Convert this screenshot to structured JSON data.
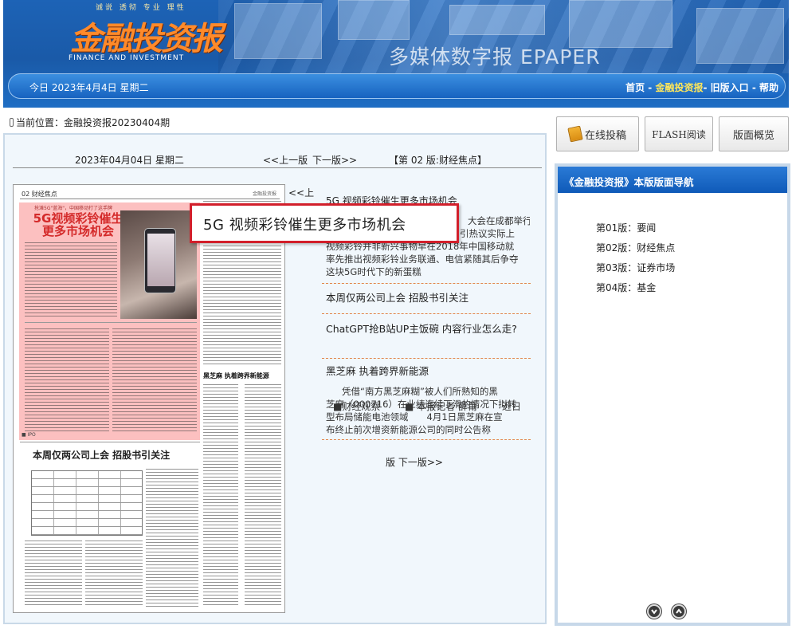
{
  "banner": {
    "slogan": "诚说  透彻  专业  理性",
    "logo_cn": "金融投资报",
    "logo_en": "FINANCE AND INVESTMENT",
    "epaper": "多媒体数字报 EPAPER",
    "today": "今日 2023年4月4日 星期二",
    "nav": {
      "home": "首页",
      "sep1": " - ",
      "paper": "金融投资报",
      "sep2": "- ",
      "old": "旧版入口",
      "sep3": " - ",
      "help": "帮助"
    }
  },
  "location": "当前位置：金融投资报20230404期",
  "page_head": {
    "date": "2023年04月04日 星期二",
    "prev": "<<上一版",
    "next": "下一版>>",
    "label": "【第 02 版:财经焦点】"
  },
  "thumbnail": {
    "section": "02 财经焦点",
    "section_right": "金融投资报",
    "pre_headline": "抢滩5G\"蓝海\"，中国移动打了这手牌",
    "headline": "5G视频彩铃催生更多市场机会",
    "sub_headline": "本周仅两公司上会 招股书引关注",
    "black_headline": "黑芝麻 执着跨界新能源",
    "tag": "■ IPO"
  },
  "tooltip": "5G 视频彩铃催生更多市场机会",
  "mini_prev": "<<上",
  "articles": [
    {
      "title": "5G 视频彩铃催生更多市场机会",
      "summary_lines": [
        "大会在成都举行",
        "引热议实际上",
        "视频彩铃并非新兴事物早在2018年中国移动就",
        "率先推出视频彩铃业务联通、电信紧随其后争夺",
        "这块5G时代下的新蛋糕"
      ]
    },
    {
      "title": "本周仅两公司上会 招股书引关注"
    },
    {
      "title": "ChatGPT抢B站UP主饭碗 内容行业怎么走?",
      "meta": [
        "■财经观察",
        "■ 本报记者 薛莆",
        "近日"
      ]
    },
    {
      "title": "黑芝麻 执着跨界新能源",
      "summary_lines": [
        "凭借“南方黑芝麻糊”被人们所熟知的黑",
        "芝麻（000716）在业绩连续下滑的情况下拟转",
        "型布局储能电池领域　　4月1日黑芝麻在宣",
        "布终止前次增资新能源公司的同时公告称"
      ]
    }
  ],
  "bottom_nav": "版  下一版>>",
  "buttons": {
    "submit": "在线投稿",
    "flash": "FLASH阅读",
    "overview": "版面概览"
  },
  "side": {
    "title": "《金融投资报》本版版面导航",
    "items": [
      "第01版：要闻",
      "第02版：财经焦点",
      "第03版：证券市场",
      "第04版：基金"
    ]
  }
}
